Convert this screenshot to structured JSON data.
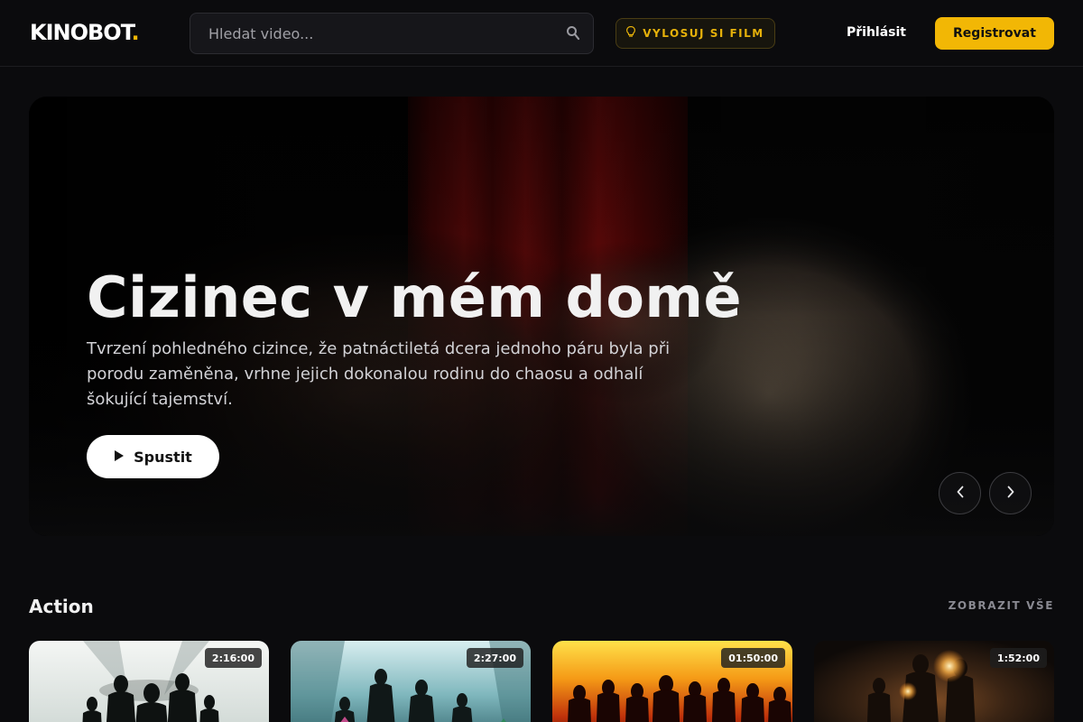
{
  "header": {
    "logo_text": "KINOBOT",
    "logo_dot": ".",
    "search_placeholder": "Hledat video...",
    "random_label": "VYLOSUJ SI FILM",
    "login_label": "Přihlásit",
    "register_label": "Registrovat"
  },
  "hero": {
    "title": "Cizinec v mém domě",
    "description": "Tvrzení pohledného cizince, že patnáctiletá dcera jednoho páru byla při porodu zaměněna, vrhne jejich dokonalou rodinu do chaosu a odhalí šokující tajemství.",
    "play_label": "Spustit"
  },
  "section": {
    "title": "Action",
    "view_all": "ZOBRAZIT VŠE",
    "cards": [
      {
        "duration": "2:16:00"
      },
      {
        "duration": "2:27:00"
      },
      {
        "duration": "01:50:00"
      },
      {
        "duration": "1:52:00"
      }
    ]
  },
  "colors": {
    "accent": "#f2b705",
    "background": "#0b0b0d"
  },
  "icons": {
    "search": "search-icon",
    "random": "lightbulb-icon",
    "play": "play-icon",
    "prev": "chevron-left-icon",
    "next": "chevron-right-icon"
  }
}
